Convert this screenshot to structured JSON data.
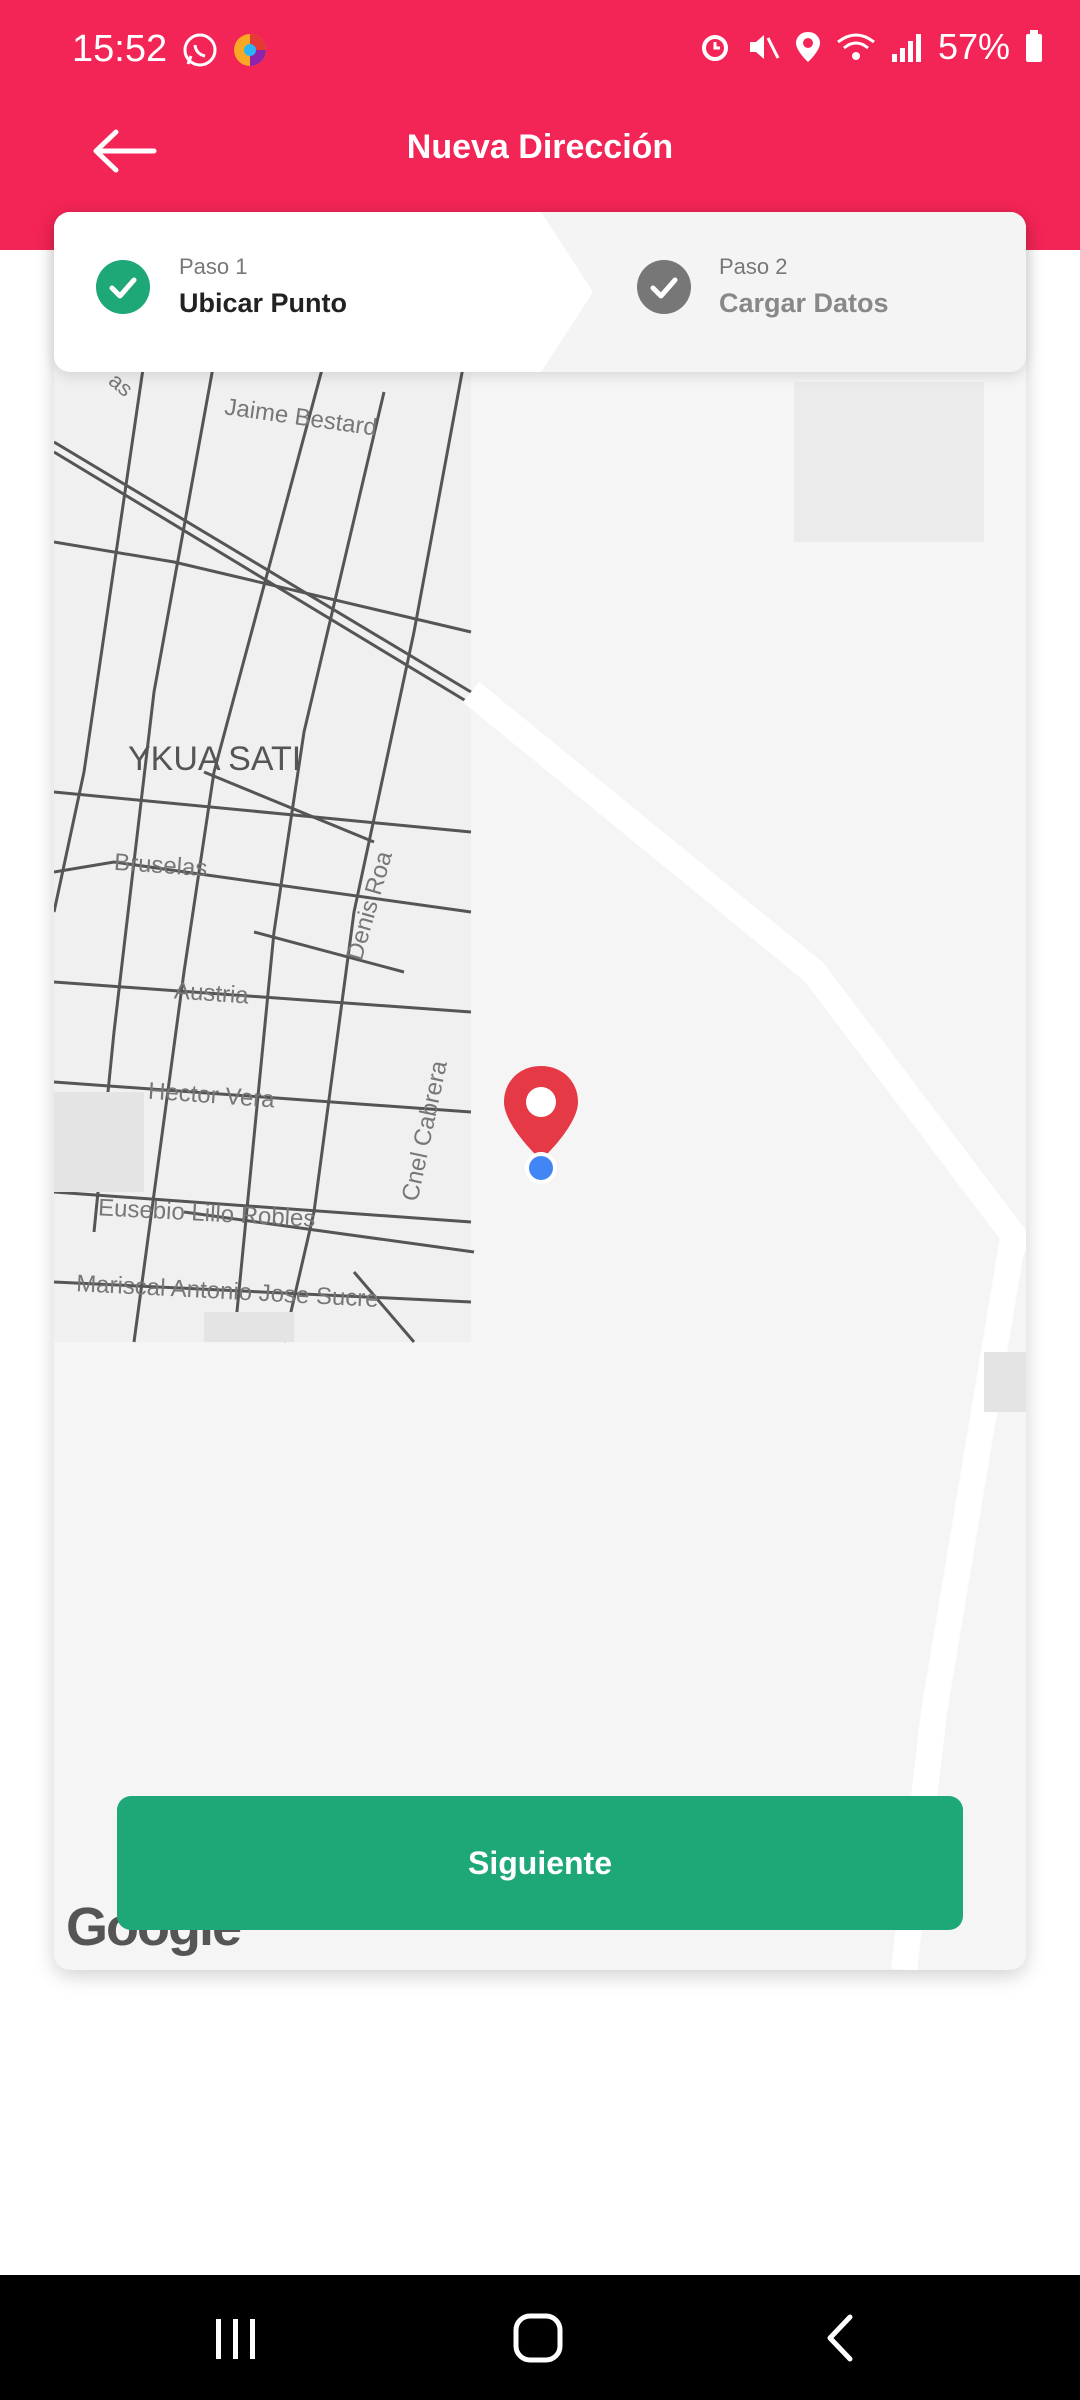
{
  "status_bar": {
    "time": "15:52",
    "battery": "57%",
    "icons": [
      "whatsapp-icon",
      "colorful-app-icon",
      "alarm-icon",
      "mute-icon",
      "location-icon",
      "wifi-icon",
      "signal-icon",
      "battery-icon"
    ]
  },
  "header": {
    "title": "Nueva Dirección",
    "back_icon": "arrow-left-icon"
  },
  "stepper": {
    "step1": {
      "label": "Paso 1",
      "title": "Ubicar Punto",
      "state": "active-complete"
    },
    "step2": {
      "label": "Paso 2",
      "title": "Cargar Datos",
      "state": "inactive"
    }
  },
  "map": {
    "labels": {
      "neighborhood": "YKUA SATI",
      "street_jaime": "Jaime Bestard",
      "street_bruselas": "Bruselas",
      "street_austria": "Austria",
      "street_denis": "Denis Roa",
      "street_hector": "Hector Vera",
      "street_cnel": "Cnel Cabrera",
      "street_eusebio": "Eusebio Lillo Robles",
      "street_mariscal": "Mariscal Antonio Jose Sucre",
      "street_fragment": "as"
    },
    "attribution": "Google"
  },
  "actions": {
    "next_label": "Siguiente"
  },
  "colors": {
    "brand": "#f32556",
    "success": "#1ea877",
    "pin": "#e53946",
    "location_dot": "#4285f4"
  }
}
